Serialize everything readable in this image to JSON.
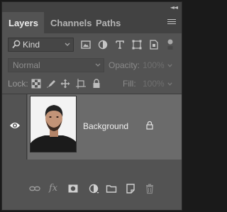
{
  "tabs": [
    {
      "label": "Layers",
      "active": true
    },
    {
      "label": "Channels",
      "active": false
    },
    {
      "label": "Paths",
      "active": false
    }
  ],
  "filter": {
    "kind_label": "Kind",
    "icons": [
      "pixel-filter-icon",
      "adjustment-filter-icon",
      "type-filter-icon",
      "shape-filter-icon",
      "smart-object-filter-icon",
      "filter-toggle-icon"
    ]
  },
  "blend": {
    "mode": "Normal",
    "opacity_label": "Opacity:",
    "opacity_value": "100%"
  },
  "lock": {
    "label": "Lock:",
    "fill_label": "Fill:",
    "fill_value": "100%",
    "icons": [
      "lock-transparent-icon",
      "lock-pixels-icon",
      "lock-position-icon",
      "lock-artboard-icon",
      "lock-all-icon"
    ]
  },
  "layers": [
    {
      "name": "Background",
      "visible": true,
      "locked": true
    }
  ],
  "bottom_bar": {
    "icons": [
      "link-layers-icon",
      "fx-icon",
      "add-mask-icon",
      "new-adjustment-icon",
      "new-group-icon",
      "new-layer-icon",
      "delete-icon"
    ],
    "fx_label": "fx"
  },
  "colors": {
    "panel_bg": "#535353",
    "tab_bar_bg": "#424242",
    "selected_layer_bg": "#6b6b6b"
  }
}
